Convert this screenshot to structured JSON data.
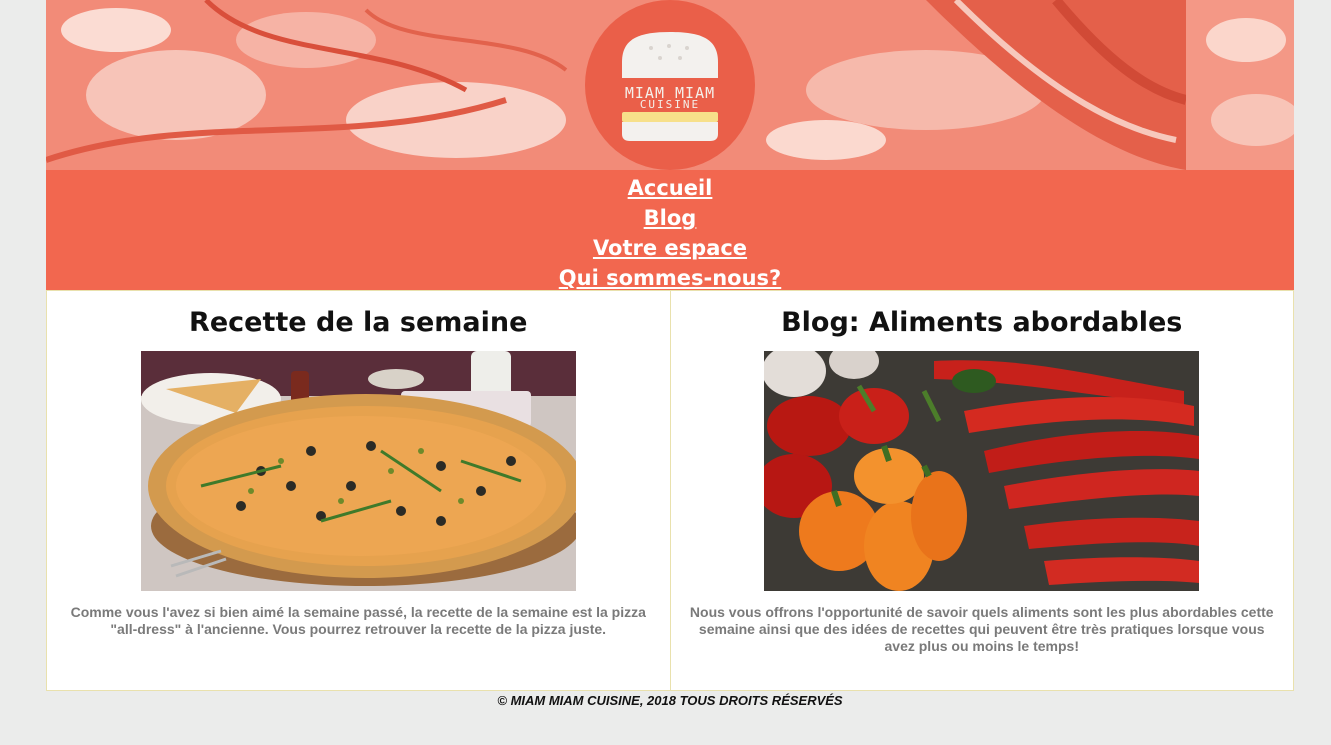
{
  "site": {
    "logo_line1": "MIAM MIAM",
    "logo_line2": "CUISINE"
  },
  "nav": {
    "items": [
      {
        "label": "Accueil"
      },
      {
        "label": "Blog"
      },
      {
        "label": "Votre espace"
      },
      {
        "label": "Qui sommes-nous?"
      }
    ]
  },
  "articles": [
    {
      "title": "Recette de la semaine",
      "text": "Comme vous l'avez si bien aimé la semaine passé, la recette de la semaine est la pizza \"all-dress\" à l'ancienne. Vous pourrez retrouver la recette de la pizza juste."
    },
    {
      "title": "Blog: Aliments abordables",
      "text": "Nous vous offrons l'opportunité de savoir quels aliments sont les plus abordables cette semaine ainsi que des idées de recettes qui peuvent être très pratiques lorsque vous avez plus ou moins le temps!"
    }
  ],
  "footer": {
    "text": "© MIAM MIAM CUISINE, 2018 TOUS DROITS RÉSERVÉS"
  },
  "colors": {
    "nav_background": "#f2674f",
    "logo_circle": "#ea5f49",
    "banner_tint": "#f08a78",
    "page_background": "#ebeceb",
    "column_border": "#e9e1ad"
  },
  "icons": {
    "logo": "burger-icon"
  }
}
